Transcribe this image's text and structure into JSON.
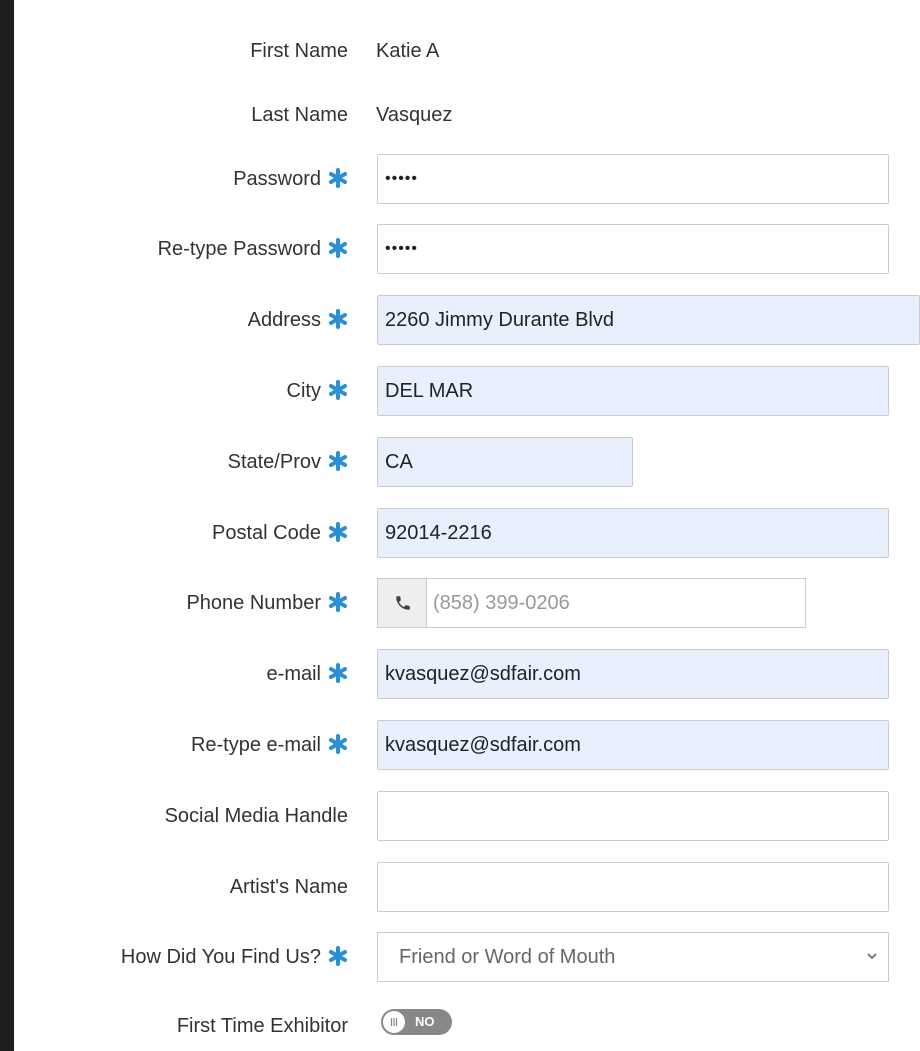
{
  "form": {
    "first_name": {
      "label": "First Name",
      "value": "Katie A"
    },
    "last_name": {
      "label": "Last Name",
      "value": "Vasquez"
    },
    "password": {
      "label": "Password",
      "value": "•••••"
    },
    "retype_password": {
      "label": "Re-type Password",
      "value": "•••••"
    },
    "address": {
      "label": "Address",
      "value": "2260 Jimmy Durante Blvd"
    },
    "city": {
      "label": "City",
      "value": "DEL MAR"
    },
    "state": {
      "label": "State/Prov",
      "value": "CA"
    },
    "postal_code": {
      "label": "Postal Code",
      "value": "92014-2216"
    },
    "phone": {
      "label": "Phone Number",
      "placeholder": "(858) 399-0206",
      "icon": "phone-icon"
    },
    "email": {
      "label": "e-mail",
      "value": "kvasquez@sdfair.com"
    },
    "retype_email": {
      "label": "Re-type e-mail",
      "value": "kvasquez@sdfair.com"
    },
    "social_media": {
      "label": "Social Media Handle",
      "value": ""
    },
    "artist_name": {
      "label": "Artist's Name",
      "value": ""
    },
    "how_found": {
      "label": "How Did You Find Us?",
      "value": "Friend or Word of Mouth"
    },
    "first_time": {
      "label": "First Time Exhibitor",
      "toggle_text": "NO"
    }
  },
  "colors": {
    "required_asterisk": "#2a8fd6",
    "autofill_background": "#e8f0fe",
    "toggle_off": "#888888"
  }
}
